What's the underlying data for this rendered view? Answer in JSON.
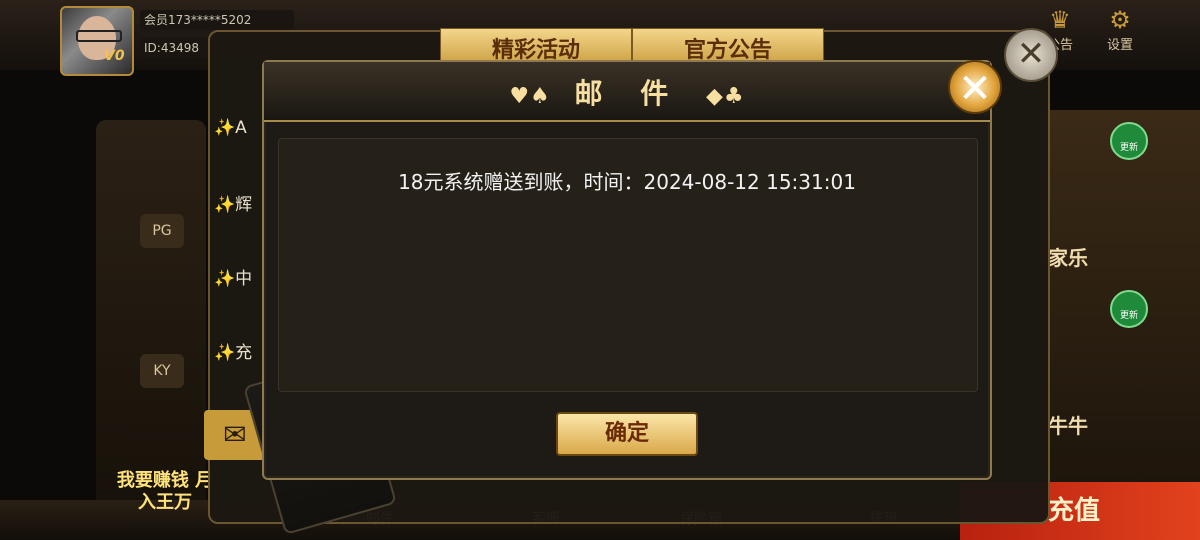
{
  "header": {
    "member": "会员173*****5202",
    "id": "ID:43498",
    "vip_badge": "V0",
    "right_icons": [
      {
        "icon": "megaphone-icon",
        "label": "公告"
      },
      {
        "icon": "gear-icon",
        "label": "设置"
      }
    ]
  },
  "lobby": {
    "side_icons": [
      "PG",
      "KY"
    ],
    "right_tiles": [
      {
        "label": "家乐",
        "badge": "更新"
      },
      {
        "label": "牛牛",
        "badge": "更新"
      }
    ],
    "bottom_items": [
      "邮件",
      "客服",
      "保险箱",
      "提现"
    ],
    "recharge_label": "充值",
    "promo_text": "我要赚钱 月入王万"
  },
  "announcement_panel": {
    "tabs": [
      "精彩活动",
      "官方公告"
    ],
    "items": [
      "✨A",
      "✨辉",
      "✨中",
      "✨充"
    ],
    "close_icon": "close-icon"
  },
  "mail_dialog": {
    "title": "邮 件",
    "suits_left": "♥♠",
    "suits_right": "◆♣",
    "message": "18元系统赠送到账，时间：2024-08-12 15:31:01",
    "confirm_label": "确定",
    "close_icon": "close-icon"
  },
  "colors": {
    "gold": "#f6dfa0",
    "button_gold": "#d9a84a",
    "dialog_bg": "#1e1b16",
    "recharge_red": "#d6321a"
  }
}
